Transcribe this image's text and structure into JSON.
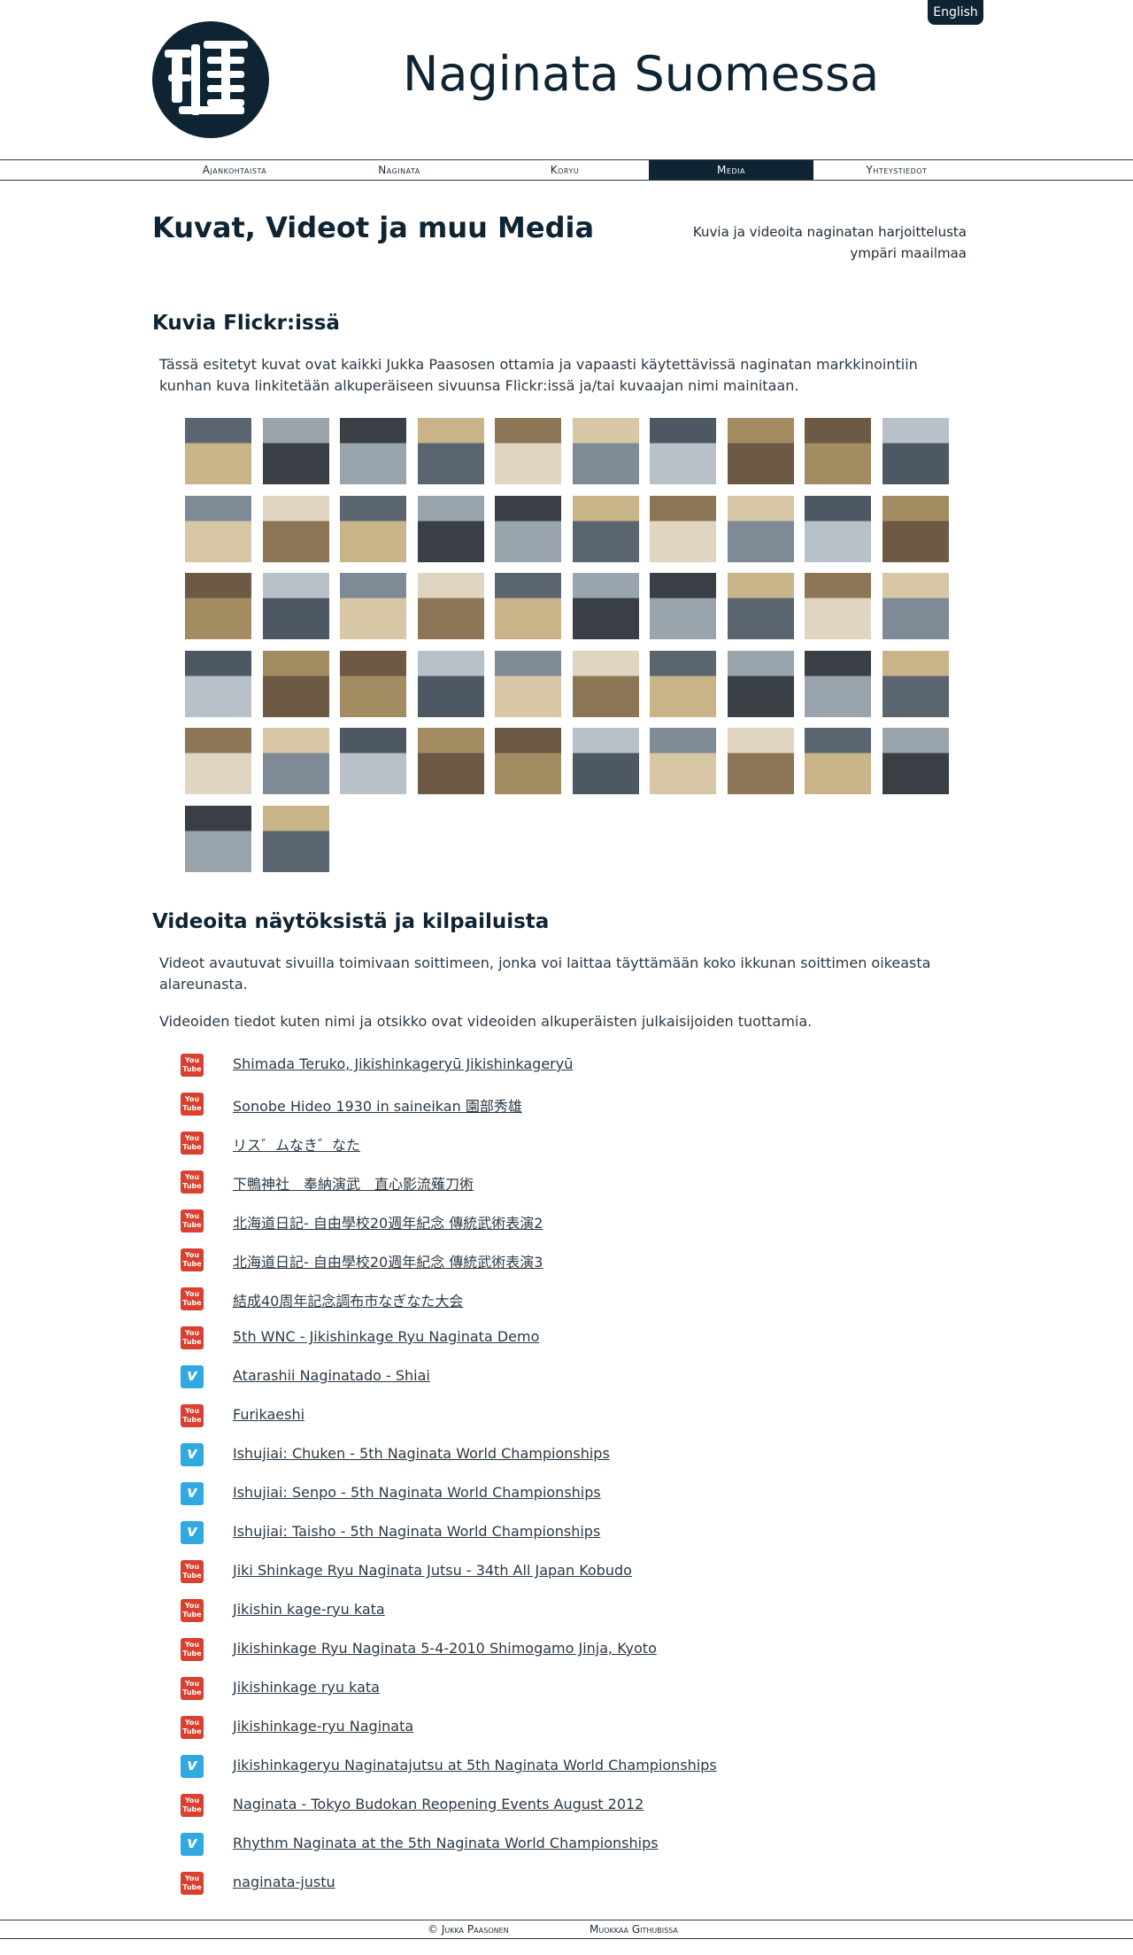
{
  "header": {
    "language_button": "English",
    "site_title": "Naginata Suomessa"
  },
  "nav": {
    "items": [
      {
        "label": "Ajankohtaista"
      },
      {
        "label": "Naginata"
      },
      {
        "label": "Koryu"
      },
      {
        "label": "Media",
        "active": true
      },
      {
        "label": "Yhteystiedot"
      }
    ]
  },
  "page": {
    "title": "Kuvat, Videot ja muu Media",
    "subtitle": "Kuvia ja videoita naginatan harjoittelusta ympäri maailmaa"
  },
  "flickr": {
    "heading": "Kuvia Flickr:issä",
    "intro": "Tässä esitetyt kuvat ovat kaikki Jukka Paasosen ottamia ja vapaasti käytettävissä naginatan markkinointiin kunhan kuva linkitetään alkuperäiseen sivuunsa Flickr:issä ja/tai kuvaajan nimi mainitaan.",
    "photo_count": 52
  },
  "videos": {
    "heading": "Videoita näytöksistä ja kilpailuista",
    "intro1": "Videot avautuvat sivuilla toimivaan soittimeen, jonka voi laittaa täyttämään koko ikkunan soittimen oikeasta alareunasta.",
    "intro2": "Videoiden tiedot kuten nimi ja otsikko ovat videoiden alkuperäisten julkaisijoiden tuottamia.",
    "items": [
      {
        "icon": "youtube",
        "title": "Shimada Teruko, Jikishinkageryū Jikishinkageryū"
      },
      {
        "icon": "youtube",
        "title": "Sonobe Hideo 1930 in saineikan 園部秀雄"
      },
      {
        "icon": "youtube",
        "title": "リス゛ムなき゛なた"
      },
      {
        "icon": "youtube",
        "title": "下鴨神社　奉納演武　直心影流薙刀術"
      },
      {
        "icon": "youtube",
        "title": "北海道日記- 自由學校20週年紀念 傳統武術表演2"
      },
      {
        "icon": "youtube",
        "title": "北海道日記- 自由學校20週年紀念 傳統武術表演3"
      },
      {
        "icon": "youtube",
        "title": "結成40周年記念調布市なぎなた大会"
      },
      {
        "icon": "youtube",
        "title": "5th WNC - Jikishinkage Ryu Naginata Demo"
      },
      {
        "icon": "vimeo",
        "title": "Atarashii Naginatado - Shiai"
      },
      {
        "icon": "youtube",
        "title": "Furikaeshi"
      },
      {
        "icon": "vimeo",
        "title": "Ishujiai: Chuken - 5th Naginata World Championships"
      },
      {
        "icon": "vimeo",
        "title": "Ishujiai: Senpo - 5th Naginata World Championships"
      },
      {
        "icon": "vimeo",
        "title": "Ishujiai: Taisho - 5th Naginata World Championships"
      },
      {
        "icon": "youtube",
        "title": "Jiki Shinkage Ryu Naginata Jutsu - 34th All Japan Kobudo"
      },
      {
        "icon": "youtube",
        "title": "Jikishin kage-ryu kata"
      },
      {
        "icon": "youtube",
        "title": "Jikishinkage Ryu Naginata 5-4-2010 Shimogamo Jinja, Kyoto"
      },
      {
        "icon": "youtube",
        "title": "Jikishinkage ryu kata"
      },
      {
        "icon": "youtube",
        "title": "Jikishinkage-ryu Naginata"
      },
      {
        "icon": "vimeo",
        "title": "Jikishinkageryu Naginatajutsu at 5th Naginata World Championships"
      },
      {
        "icon": "youtube",
        "title": "Naginata - Tokyo Budokan Reopening Events August 2012"
      },
      {
        "icon": "vimeo",
        "title": "Rhythm Naginata at the 5th Naginata World Championships"
      },
      {
        "icon": "youtube",
        "title": "naginata-justu"
      }
    ]
  },
  "footer": {
    "copyright": "© Jukka Paasonen",
    "edit_link": "Muokkaa Githubissa"
  },
  "colors": {
    "brand": "#0f2433",
    "youtube": "#d9402f",
    "vimeo": "#2fa9df"
  }
}
